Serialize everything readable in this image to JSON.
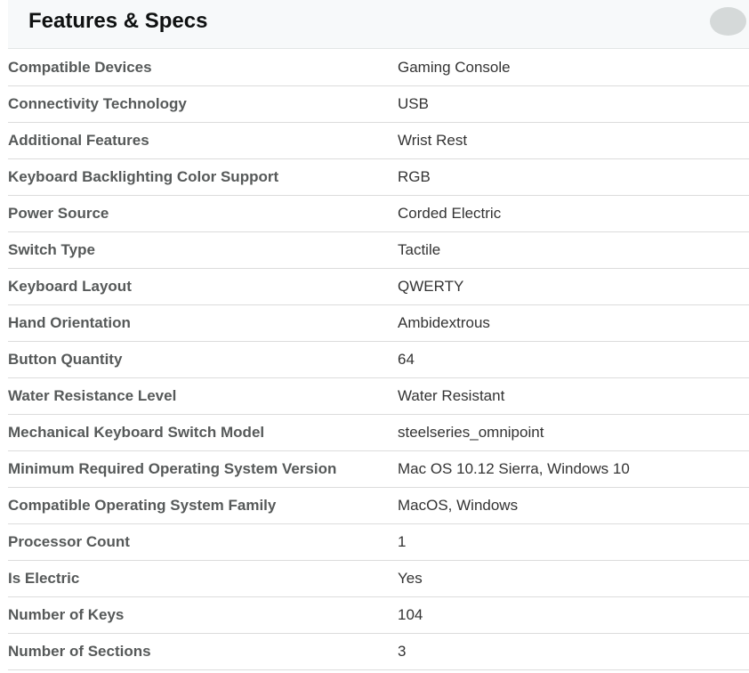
{
  "header": {
    "title": "Features & Specs"
  },
  "specs": [
    {
      "label": "Compatible Devices",
      "value": "Gaming Console"
    },
    {
      "label": "Connectivity Technology",
      "value": "USB"
    },
    {
      "label": "Additional Features",
      "value": "Wrist Rest"
    },
    {
      "label": "Keyboard Backlighting Color Support",
      "value": "RGB"
    },
    {
      "label": "Power Source",
      "value": "Corded Electric"
    },
    {
      "label": "Switch Type",
      "value": "Tactile"
    },
    {
      "label": "Keyboard Layout",
      "value": "QWERTY"
    },
    {
      "label": "Hand Orientation",
      "value": "Ambidextrous"
    },
    {
      "label": "Button Quantity",
      "value": "64"
    },
    {
      "label": "Water Resistance Level",
      "value": "Water Resistant"
    },
    {
      "label": "Mechanical Keyboard Switch Model",
      "value": "steelseries_omnipoint"
    },
    {
      "label": "Minimum Required Operating System Version",
      "value": "Mac OS 10.12 Sierra, Windows 10"
    },
    {
      "label": "Compatible Operating System Family",
      "value": "MacOS, Windows"
    },
    {
      "label": "Processor Count",
      "value": "1"
    },
    {
      "label": "Is Electric",
      "value": "Yes"
    },
    {
      "label": "Number of Keys",
      "value": "104"
    },
    {
      "label": "Number of Sections",
      "value": "3"
    }
  ],
  "colors": {
    "header_background": "#f7f9fa",
    "label_text": "#565959",
    "value_text": "#333333",
    "divider": "#dcdcdc",
    "toggle": "#d5d9d9"
  }
}
